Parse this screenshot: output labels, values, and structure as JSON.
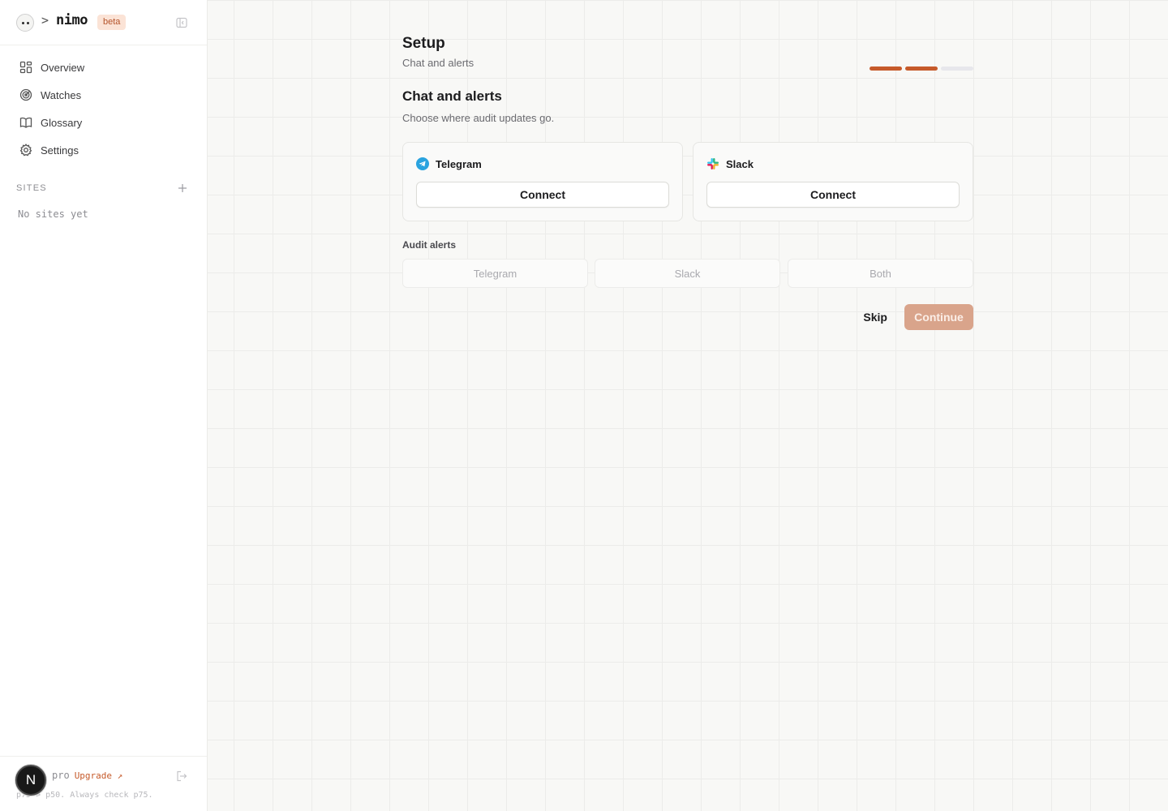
{
  "brand": {
    "caret": ">",
    "name": "nimo",
    "badge": "beta"
  },
  "nav": {
    "items": [
      {
        "label": "Overview",
        "icon": "overview-grid-icon"
      },
      {
        "label": "Watches",
        "icon": "radar-icon"
      },
      {
        "label": "Glossary",
        "icon": "book-open-icon"
      },
      {
        "label": "Settings",
        "icon": "gear-icon"
      }
    ]
  },
  "sites": {
    "heading": "SITES",
    "empty": "No sites yet"
  },
  "footer": {
    "avatar_initial": "N",
    "plan": "pro",
    "upgrade": "Upgrade ↗",
    "tip": "p75 > p50. Always check p75."
  },
  "setup": {
    "title": "Setup",
    "subtitle": "Chat and alerts",
    "progress": {
      "completed_steps": 2,
      "total_steps": 3
    },
    "section_title": "Chat and alerts",
    "section_desc": "Choose where audit updates go."
  },
  "integrations": [
    {
      "name": "Telegram",
      "icon": "telegram-icon",
      "action": "Connect"
    },
    {
      "name": "Slack",
      "icon": "slack-icon",
      "action": "Connect"
    }
  ],
  "audit_alerts": {
    "label": "Audit alerts",
    "options": [
      "Telegram",
      "Slack",
      "Both"
    ]
  },
  "actions": {
    "skip": "Skip",
    "continue": "Continue"
  },
  "colors": {
    "accent": "#c65a2a",
    "accent_disabled": "#d9a48b",
    "badge_bg": "#fbe3d6"
  }
}
